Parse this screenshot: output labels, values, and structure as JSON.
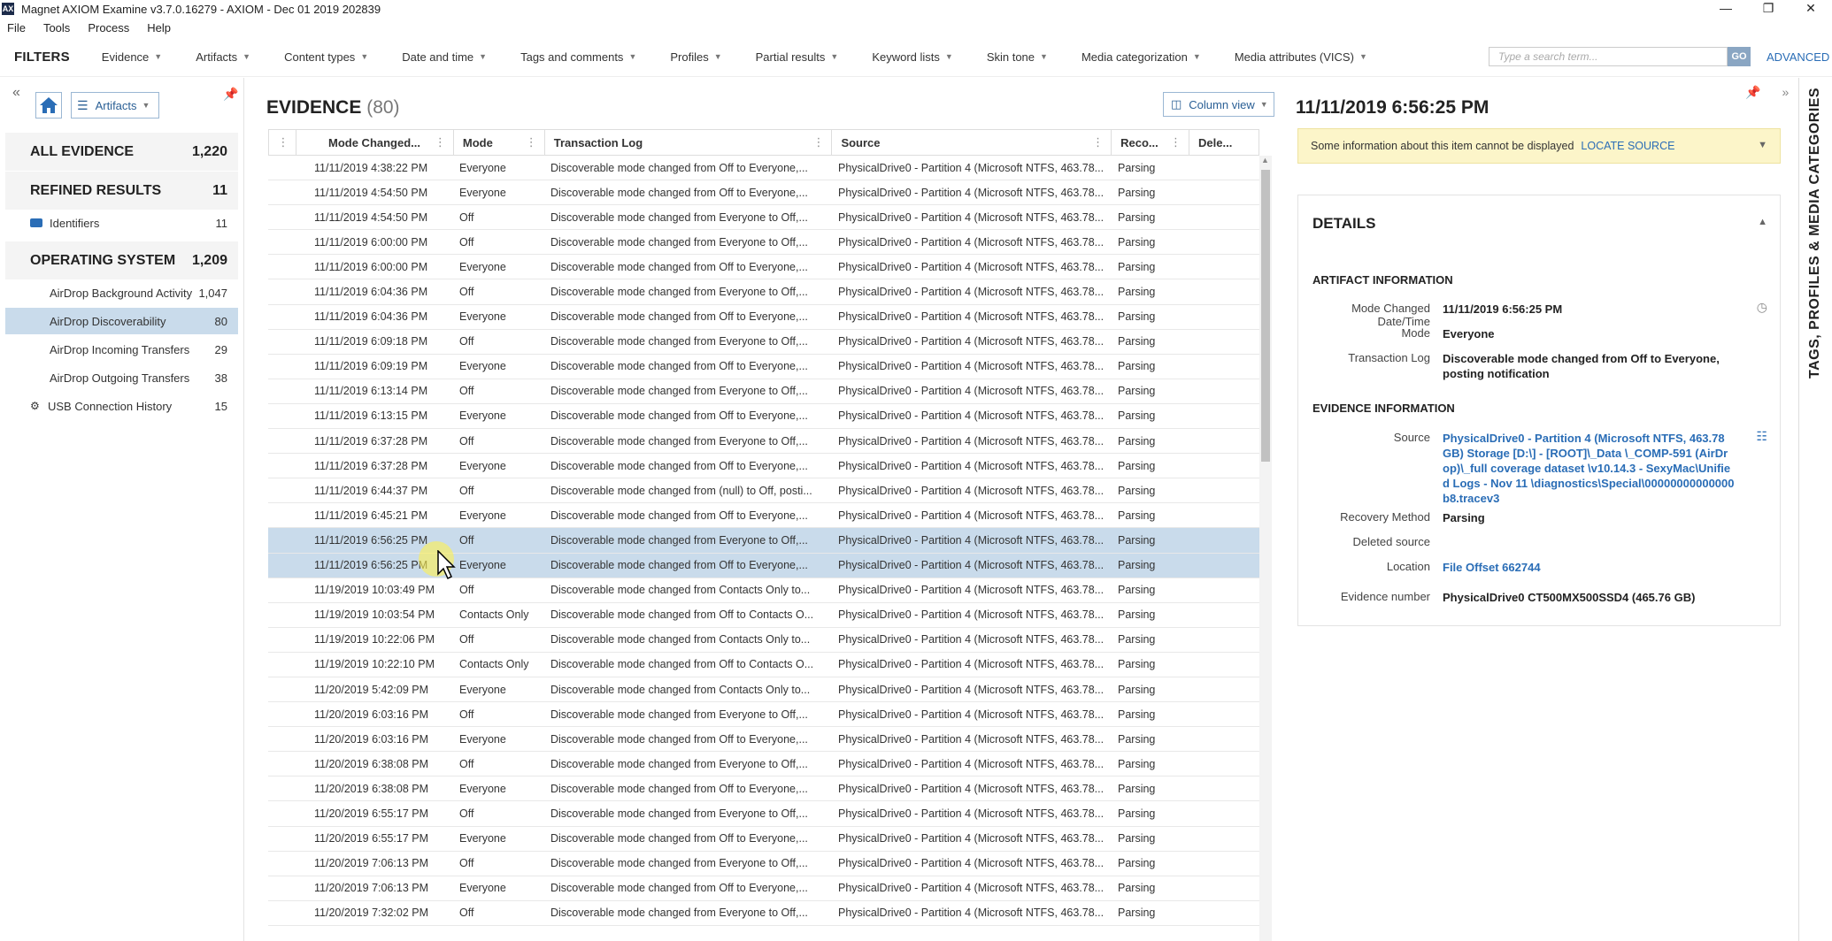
{
  "window": {
    "title": "Magnet AXIOM Examine v3.7.0.16279 - AXIOM - Dec 01 2019 202839",
    "app_icon": "AX"
  },
  "menu": [
    "File",
    "Tools",
    "Process",
    "Help"
  ],
  "filters": {
    "label": "FILTERS",
    "items": [
      "Evidence",
      "Artifacts",
      "Content types",
      "Date and time",
      "Tags and comments",
      "Profiles",
      "Partial results",
      "Keyword lists",
      "Skin tone",
      "Media categorization",
      "Media attributes (VICS)"
    ],
    "search_placeholder": "Type a search term...",
    "go_label": "GO",
    "advanced_label": "ADVANCED"
  },
  "left": {
    "artifacts_label": "Artifacts",
    "all_evidence": {
      "label": "ALL EVIDENCE",
      "count": "1,220"
    },
    "refined": {
      "label": "REFINED RESULTS",
      "count": "11"
    },
    "identifiers": {
      "label": "Identifiers",
      "count": "11"
    },
    "os": {
      "label": "OPERATING SYSTEM",
      "count": "1,209"
    },
    "os_items": [
      {
        "label": "AirDrop Background Activity",
        "count": "1,047"
      },
      {
        "label": "AirDrop Discoverability",
        "count": "80"
      },
      {
        "label": "AirDrop Incoming Transfers",
        "count": "29"
      },
      {
        "label": "AirDrop Outgoing Transfers",
        "count": "38"
      }
    ],
    "usb": {
      "label": "USB Connection History",
      "count": "15"
    }
  },
  "center": {
    "title": "EVIDENCE",
    "count": "(80)",
    "column_view_label": "Column view",
    "columns": [
      "Mode Changed...",
      "Mode",
      "Transaction Log",
      "Source",
      "Reco...",
      "Dele..."
    ],
    "rows": [
      [
        "11/11/2019 4:38:22 PM",
        "Everyone",
        "Discoverable mode changed from Off to Everyone,...",
        "PhysicalDrive0 - Partition 4 (Microsoft NTFS, 463.78...",
        "Parsing",
        ""
      ],
      [
        "11/11/2019 4:54:50 PM",
        "Everyone",
        "Discoverable mode changed from Off to Everyone,...",
        "PhysicalDrive0 - Partition 4 (Microsoft NTFS, 463.78...",
        "Parsing",
        ""
      ],
      [
        "11/11/2019 4:54:50 PM",
        "Off",
        "Discoverable mode changed from Everyone to Off,...",
        "PhysicalDrive0 - Partition 4 (Microsoft NTFS, 463.78...",
        "Parsing",
        ""
      ],
      [
        "11/11/2019 6:00:00 PM",
        "Off",
        "Discoverable mode changed from Everyone to Off,...",
        "PhysicalDrive0 - Partition 4 (Microsoft NTFS, 463.78...",
        "Parsing",
        ""
      ],
      [
        "11/11/2019 6:00:00 PM",
        "Everyone",
        "Discoverable mode changed from Off to Everyone,...",
        "PhysicalDrive0 - Partition 4 (Microsoft NTFS, 463.78...",
        "Parsing",
        ""
      ],
      [
        "11/11/2019 6:04:36 PM",
        "Off",
        "Discoverable mode changed from Everyone to Off,...",
        "PhysicalDrive0 - Partition 4 (Microsoft NTFS, 463.78...",
        "Parsing",
        ""
      ],
      [
        "11/11/2019 6:04:36 PM",
        "Everyone",
        "Discoverable mode changed from Off to Everyone,...",
        "PhysicalDrive0 - Partition 4 (Microsoft NTFS, 463.78...",
        "Parsing",
        ""
      ],
      [
        "11/11/2019 6:09:18 PM",
        "Off",
        "Discoverable mode changed from Everyone to Off,...",
        "PhysicalDrive0 - Partition 4 (Microsoft NTFS, 463.78...",
        "Parsing",
        ""
      ],
      [
        "11/11/2019 6:09:19 PM",
        "Everyone",
        "Discoverable mode changed from Off to Everyone,...",
        "PhysicalDrive0 - Partition 4 (Microsoft NTFS, 463.78...",
        "Parsing",
        ""
      ],
      [
        "11/11/2019 6:13:14 PM",
        "Off",
        "Discoverable mode changed from Everyone to Off,...",
        "PhysicalDrive0 - Partition 4 (Microsoft NTFS, 463.78...",
        "Parsing",
        ""
      ],
      [
        "11/11/2019 6:13:15 PM",
        "Everyone",
        "Discoverable mode changed from Off to Everyone,...",
        "PhysicalDrive0 - Partition 4 (Microsoft NTFS, 463.78...",
        "Parsing",
        ""
      ],
      [
        "11/11/2019 6:37:28 PM",
        "Off",
        "Discoverable mode changed from Everyone to Off,...",
        "PhysicalDrive0 - Partition 4 (Microsoft NTFS, 463.78...",
        "Parsing",
        ""
      ],
      [
        "11/11/2019 6:37:28 PM",
        "Everyone",
        "Discoverable mode changed from Off to Everyone,...",
        "PhysicalDrive0 - Partition 4 (Microsoft NTFS, 463.78...",
        "Parsing",
        ""
      ],
      [
        "11/11/2019 6:44:37 PM",
        "Off",
        "Discoverable mode changed from (null) to Off, posti...",
        "PhysicalDrive0 - Partition 4 (Microsoft NTFS, 463.78...",
        "Parsing",
        ""
      ],
      [
        "11/11/2019 6:45:21 PM",
        "Everyone",
        "Discoverable mode changed from Off to Everyone,...",
        "PhysicalDrive0 - Partition 4 (Microsoft NTFS, 463.78...",
        "Parsing",
        ""
      ],
      [
        "11/11/2019 6:56:25 PM",
        "Off",
        "Discoverable mode changed from Everyone to Off,...",
        "PhysicalDrive0 - Partition 4 (Microsoft NTFS, 463.78...",
        "Parsing",
        ""
      ],
      [
        "11/11/2019 6:56:25 PM",
        "Everyone",
        "Discoverable mode changed from Off to Everyone,...",
        "PhysicalDrive0 - Partition 4 (Microsoft NTFS, 463.78...",
        "Parsing",
        ""
      ],
      [
        "11/19/2019 10:03:49 PM",
        "Off",
        "Discoverable mode changed from Contacts Only to...",
        "PhysicalDrive0 - Partition 4 (Microsoft NTFS, 463.78...",
        "Parsing",
        ""
      ],
      [
        "11/19/2019 10:03:54 PM",
        "Contacts Only",
        "Discoverable mode changed from Off to Contacts O...",
        "PhysicalDrive0 - Partition 4 (Microsoft NTFS, 463.78...",
        "Parsing",
        ""
      ],
      [
        "11/19/2019 10:22:06 PM",
        "Off",
        "Discoverable mode changed from Contacts Only to...",
        "PhysicalDrive0 - Partition 4 (Microsoft NTFS, 463.78...",
        "Parsing",
        ""
      ],
      [
        "11/19/2019 10:22:10 PM",
        "Contacts Only",
        "Discoverable mode changed from Off to Contacts O...",
        "PhysicalDrive0 - Partition 4 (Microsoft NTFS, 463.78...",
        "Parsing",
        ""
      ],
      [
        "11/20/2019 5:42:09 PM",
        "Everyone",
        "Discoverable mode changed from Contacts Only to...",
        "PhysicalDrive0 - Partition 4 (Microsoft NTFS, 463.78...",
        "Parsing",
        ""
      ],
      [
        "11/20/2019 6:03:16 PM",
        "Off",
        "Discoverable mode changed from Everyone to Off,...",
        "PhysicalDrive0 - Partition 4 (Microsoft NTFS, 463.78...",
        "Parsing",
        ""
      ],
      [
        "11/20/2019 6:03:16 PM",
        "Everyone",
        "Discoverable mode changed from Off to Everyone,...",
        "PhysicalDrive0 - Partition 4 (Microsoft NTFS, 463.78...",
        "Parsing",
        ""
      ],
      [
        "11/20/2019 6:38:08 PM",
        "Off",
        "Discoverable mode changed from Everyone to Off,...",
        "PhysicalDrive0 - Partition 4 (Microsoft NTFS, 463.78...",
        "Parsing",
        ""
      ],
      [
        "11/20/2019 6:38:08 PM",
        "Everyone",
        "Discoverable mode changed from Off to Everyone,...",
        "PhysicalDrive0 - Partition 4 (Microsoft NTFS, 463.78...",
        "Parsing",
        ""
      ],
      [
        "11/20/2019 6:55:17 PM",
        "Off",
        "Discoverable mode changed from Everyone to Off,...",
        "PhysicalDrive0 - Partition 4 (Microsoft NTFS, 463.78...",
        "Parsing",
        ""
      ],
      [
        "11/20/2019 6:55:17 PM",
        "Everyone",
        "Discoverable mode changed from Off to Everyone,...",
        "PhysicalDrive0 - Partition 4 (Microsoft NTFS, 463.78...",
        "Parsing",
        ""
      ],
      [
        "11/20/2019 7:06:13 PM",
        "Off",
        "Discoverable mode changed from Everyone to Off,...",
        "PhysicalDrive0 - Partition 4 (Microsoft NTFS, 463.78...",
        "Parsing",
        ""
      ],
      [
        "11/20/2019 7:06:13 PM",
        "Everyone",
        "Discoverable mode changed from Off to Everyone,...",
        "PhysicalDrive0 - Partition 4 (Microsoft NTFS, 463.78...",
        "Parsing",
        ""
      ],
      [
        "11/20/2019 7:32:02 PM",
        "Off",
        "Discoverable mode changed from Everyone to Off,...",
        "PhysicalDrive0 - Partition 4 (Microsoft NTFS, 463.78...",
        "Parsing",
        ""
      ]
    ],
    "selected_rows": [
      15,
      16
    ]
  },
  "right": {
    "title": "11/11/2019 6:56:25 PM",
    "banner_text": "Some information about this item cannot be displayed",
    "banner_link": "LOCATE SOURCE",
    "details_title": "DETAILS",
    "artifact_info_title": "ARTIFACT INFORMATION",
    "mode_changed_label": "Mode Changed Date/Time",
    "mode_changed_value": "11/11/2019 6:56:25 PM",
    "mode_label": "Mode",
    "mode_value": "Everyone",
    "tlog_label": "Transaction Log",
    "tlog_value": "Discoverable mode changed from Off to Everyone, posting notification",
    "evidence_info_title": "EVIDENCE INFORMATION",
    "source_label": "Source",
    "source_value": "PhysicalDrive0 - Partition 4 (Microsoft NTFS, 463.78 GB) Storage [D:\\] - [ROOT]\\_Data \\_COMP-591 (AirDrop)\\_full coverage dataset \\v10.14.3 - SexyMac\\Unified Logs - Nov 11 \\diagnostics\\Special\\00000000000000b8.tracev3",
    "recovery_label": "Recovery Method",
    "recovery_value": "Parsing",
    "deleted_label": "Deleted source",
    "deleted_value": "",
    "location_label": "Location",
    "location_value": "File Offset 662744",
    "evnum_label": "Evidence number",
    "evnum_value": "PhysicalDrive0 CT500MX500SSD4 (465.76 GB)"
  },
  "side_tab_label": "TAGS, PROFILES & MEDIA CATEGORIES",
  "colors": {
    "selection": "#c9dbeb",
    "link": "#2a6db6",
    "banner": "#fcf5c9"
  }
}
